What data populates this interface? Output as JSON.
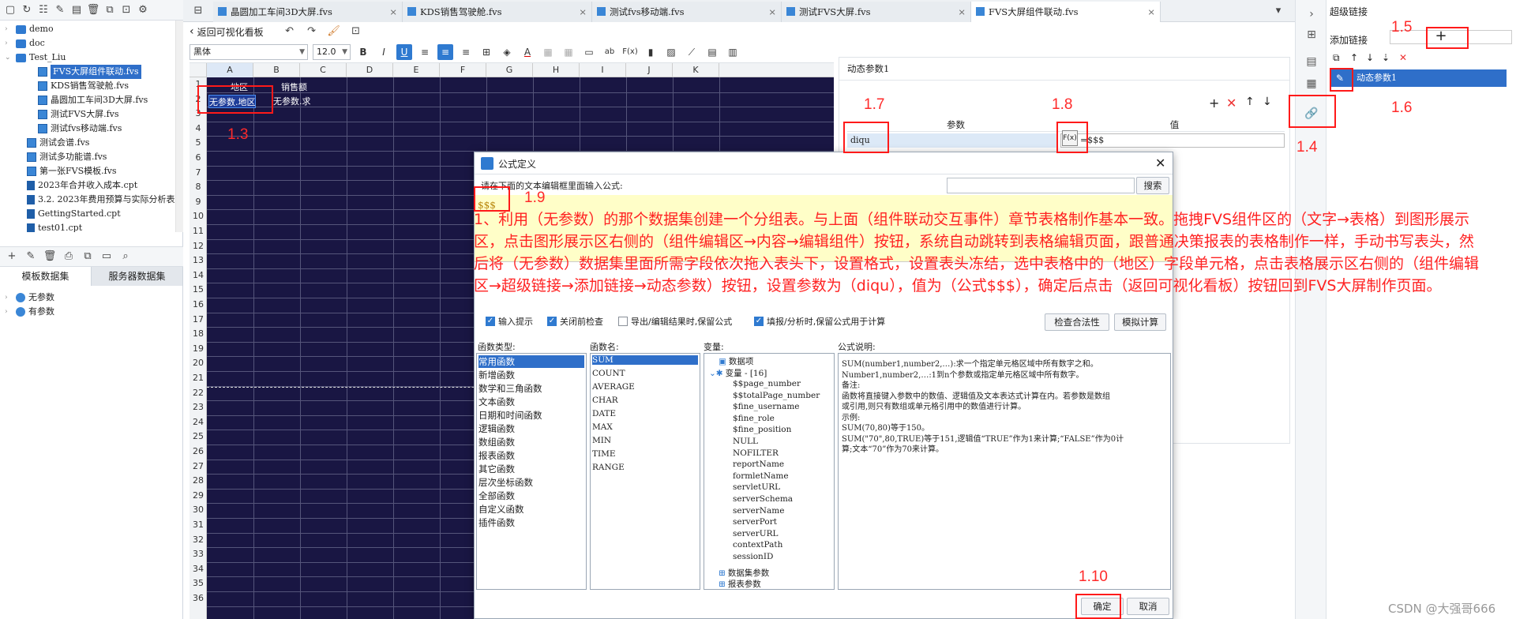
{
  "left_panel": {
    "tree": [
      {
        "label": "demo",
        "type": "folder",
        "indent": 0
      },
      {
        "label": "doc",
        "type": "folder",
        "indent": 0
      },
      {
        "label": "Test_Liu",
        "type": "folder",
        "indent": 0
      },
      {
        "label": "FVS大屏组件联动.fvs",
        "type": "fvs",
        "indent": 2,
        "selected": true
      },
      {
        "label": "KDS销售驾驶舱.fvs",
        "type": "fvs",
        "indent": 2
      },
      {
        "label": "晶圆加工车间3D大屏.fvs",
        "type": "fvs",
        "indent": 2
      },
      {
        "label": "测试FVS大屏.fvs",
        "type": "fvs",
        "indent": 2
      },
      {
        "label": "测试fvs移动端.fvs",
        "type": "fvs",
        "indent": 2
      },
      {
        "label": "测试会谱.fvs",
        "type": "fvs",
        "indent": 1
      },
      {
        "label": "测试多功能谱.fvs",
        "type": "fvs",
        "indent": 1
      },
      {
        "label": "第一张FVS模板.fvs",
        "type": "fvs",
        "indent": 1
      },
      {
        "label": "2023年合并收入成本.cpt",
        "type": "cpt",
        "indent": 1
      },
      {
        "label": "3.2. 2023年费用预算与实际分析表",
        "type": "cpt",
        "indent": 1
      },
      {
        "label": "GettingStarted.cpt",
        "type": "cpt",
        "indent": 1
      },
      {
        "label": "test01.cpt",
        "type": "cpt",
        "indent": 1
      }
    ],
    "ds_tabs": [
      "模板数据集",
      "服务器数据集"
    ],
    "datasets": [
      "无参数",
      "有参数"
    ]
  },
  "tabs": [
    "晶圆加工车间3D大屏.fvs",
    "KDS销售驾驶舱.fvs",
    "测试fvs移动端.fvs",
    "测试FVS大屏.fvs",
    "FVS大屏组件联动.fvs"
  ],
  "subbar": {
    "back_label": "返回可视化看板"
  },
  "format": {
    "font": "黑体",
    "size": "12.0",
    "bold": "B",
    "italic": "I",
    "underline": "U"
  },
  "grid": {
    "columns": [
      "A",
      "B",
      "C",
      "D",
      "E",
      "F",
      "G",
      "H",
      "I",
      "J",
      "K"
    ],
    "rows": [
      "1",
      "2",
      "3",
      "4",
      "5",
      "6",
      "7",
      "8",
      "9",
      "10",
      "11",
      "12",
      "13",
      "14",
      "15",
      "16",
      "17",
      "18",
      "19",
      "20",
      "21",
      "22",
      "23",
      "24",
      "25",
      "26",
      "27",
      "28",
      "29",
      "30",
      "31",
      "32",
      "33",
      "34",
      "35",
      "36"
    ],
    "a1": "地区",
    "b1": "销售额",
    "a2": "无参数.地区",
    "b2": "无参数.求"
  },
  "param_panel": {
    "title": "动态参数1",
    "col_param": "参数",
    "col_value": "值",
    "row_param": "diqu",
    "row_value": "=$$$",
    "fx": "F(x)"
  },
  "right_panel": {
    "title": "超级链接",
    "add_link": "添加链接",
    "add_btn": "+",
    "item": "动态参数1"
  },
  "dialog": {
    "title": "公式定义",
    "hint": "请在下面的文本编辑框里面输入公式:",
    "search_btn": "搜索",
    "formula": "$$$",
    "opts": [
      "输入提示",
      "关闭前检查",
      "导出/编辑结果时,保留公式",
      "填报/分析时,保留公式用于计算"
    ],
    "check_btn": "检查合法性",
    "simulate_btn": "模拟计算",
    "fn_type_label": "函数类型:",
    "fn_name_label": "函数名:",
    "var_label": "变量:",
    "desc_label": "公式说明:",
    "fn_types": [
      "常用函数",
      "新增函数",
      "数学和三角函数",
      "文本函数",
      "日期和时间函数",
      "逻辑函数",
      "数组函数",
      "报表函数",
      "其它函数",
      "层次坐标函数",
      "全部函数",
      "自定义函数",
      "插件函数"
    ],
    "fn_names": [
      "SUM",
      "COUNT",
      "AVERAGE",
      "CHAR",
      "DATE",
      "MAX",
      "MIN",
      "TIME",
      "RANGE"
    ],
    "vars_top": "数据项",
    "vars_group": "变量 - [16]",
    "vars": [
      "$$page_number",
      "$$totalPage_number",
      "$fine_username",
      "$fine_role",
      "$fine_position",
      "NULL",
      "NOFILTER",
      "reportName",
      "formletName",
      "servletURL",
      "serverSchema",
      "serverName",
      "serverPort",
      "serverURL",
      "contextPath",
      "sessionID"
    ],
    "vars_bottom": [
      "数据集参数",
      "报表参数"
    ],
    "desc_lines": [
      "SUM(number1,number2,…):求一个指定单元格区域中所有数字之和。",
      "Number1,number2,…:1到n个参数或指定单元格区域中所有数字。",
      "备注:",
      "函数将直接键入参数中的数值、逻辑值及文本表达式计算在内。若参数是数组",
      "或引用,则只有数组或单元格引用中的数值进行计算。",
      "示例:",
      "SUM(70,80)等于150。",
      "SUM(\"70\",80,TRUE)等于151,逻辑值“TRUE”作为1来计算;“FALSE”作为0计",
      "算;文本“70”作为70来计算。"
    ],
    "ok_btn": "确定",
    "cancel_btn": "取消"
  },
  "annotations": {
    "n13": "1.3",
    "n14": "1.4",
    "n15": "1.5",
    "n16": "1.6",
    "n17": "1.7",
    "n18": "1.8",
    "n19": "1.9",
    "n110": "1.10",
    "paragraph": "1、利用（无参数）的那个数据集创建一个分组表。与上面（组件联动交互事件）章节表格制作基本一致。拖拽FVS组件区的（文字→表格）到图形展示区，点击图形展示区右侧的（组件编辑区→内容→编辑组件）按钮，系统自动跳转到表格编辑页面，跟普通决策报表的表格制作一样，手动书写表头，然后将（无参数）数据集里面所需字段依次拖入表头下，设置格式，设置表头冻结，选中表格中的（地区）字段单元格，点击表格展示区右侧的（组件编辑区→超级链接→添加链接→动态参数）按钮，设置参数为（diqu），值为（公式$$$），确定后点击（返回可视化看板）按钮回到FVS大屏制作页面。"
  },
  "watermark": "CSDN @大强哥666",
  "colors": {
    "accent": "#2f7ad0",
    "grid_bg": "#191643",
    "annotation": "#ff2222"
  }
}
